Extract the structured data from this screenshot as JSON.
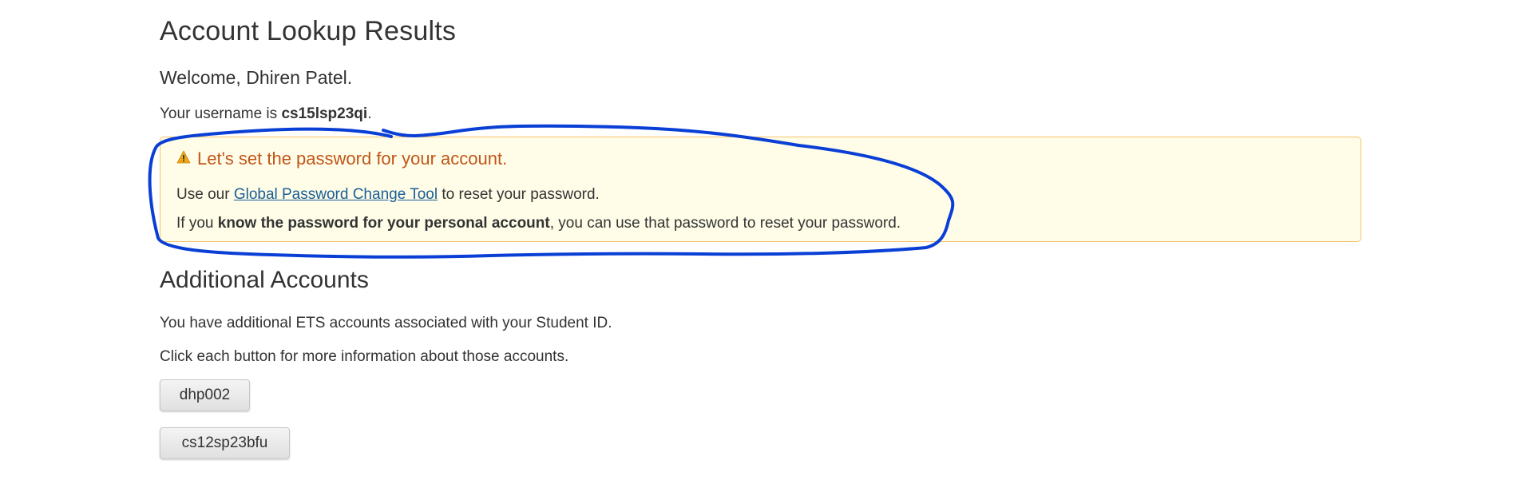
{
  "page": {
    "title": "Account Lookup Results",
    "welcome": "Welcome, Dhiren Patel.",
    "username_prefix": "Your username is ",
    "username": "cs15lsp23qi",
    "username_suffix": "."
  },
  "alert": {
    "icon": "warning-icon",
    "heading": "Let's set the password for your account.",
    "line1_prefix": "Use our ",
    "line1_link": "Global Password Change Tool",
    "line1_suffix": " to reset your password.",
    "line2_prefix": "If you ",
    "line2_bold": "know the password for your personal account",
    "line2_suffix": ", you can use that password to reset your password.",
    "colors": {
      "background": "#fffde8",
      "border": "#f5c26a",
      "heading": "#c0561a",
      "link": "#1a5e96"
    }
  },
  "additional": {
    "title": "Additional Accounts",
    "para1": "You have additional ETS accounts associated with your Student ID.",
    "para2": "Click each button for more information about those accounts.",
    "accounts": [
      "dhp002",
      "cs12sp23bfu"
    ]
  },
  "annotation": {
    "type": "hand-drawn-circle",
    "color": "#0a3fd6"
  }
}
